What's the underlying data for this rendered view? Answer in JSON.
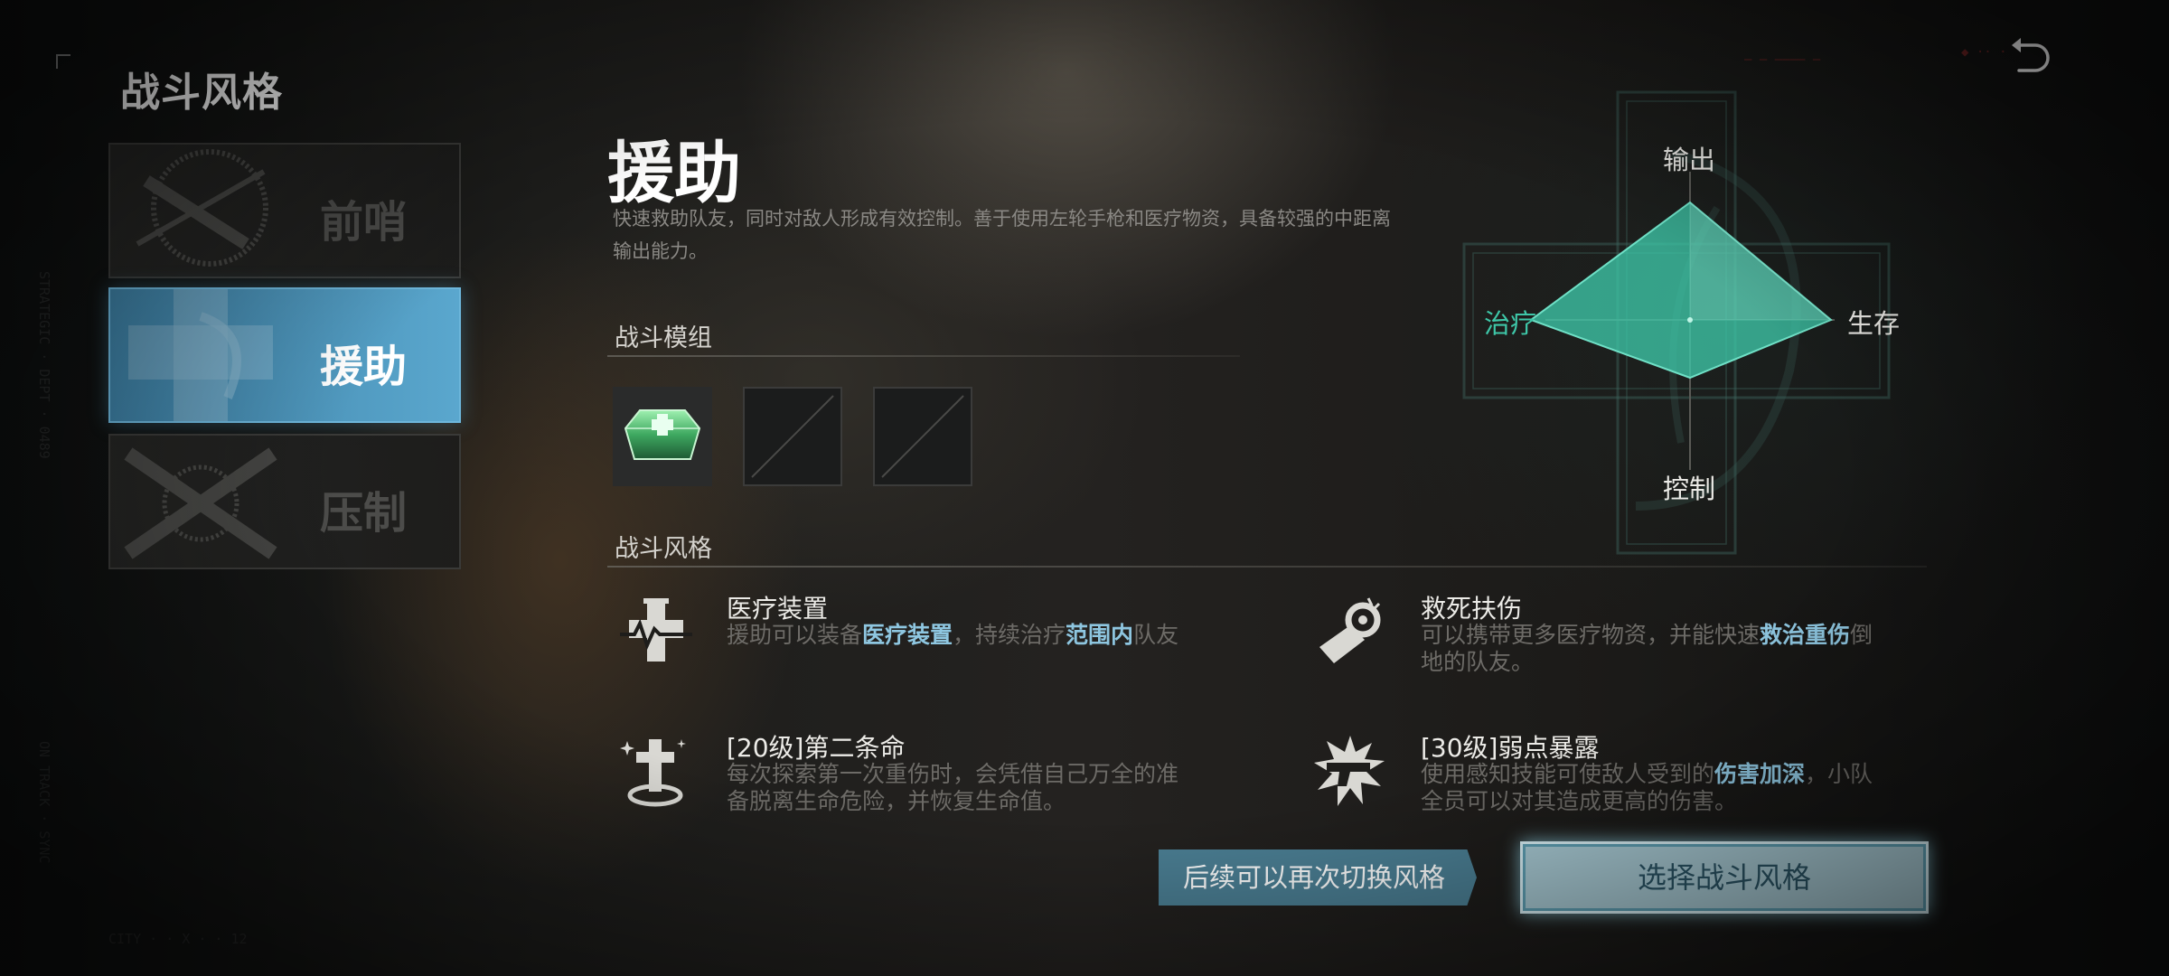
{
  "header": {
    "title": "战斗风格"
  },
  "sidebar": {
    "items": [
      {
        "label": "前哨",
        "selected": false
      },
      {
        "label": "援助",
        "selected": true
      },
      {
        "label": "压制",
        "selected": false
      }
    ]
  },
  "role": {
    "name": "援助",
    "description": "快速救助队友，同时对敌人形成有效控制。善于使用左轮手枪和医疗物资，具备较强的中距离输出能力。"
  },
  "modules": {
    "label": "战斗模组",
    "slots": [
      {
        "state": "filled",
        "icon": "medkit-gem-icon"
      },
      {
        "state": "empty"
      },
      {
        "state": "empty"
      }
    ]
  },
  "traits": {
    "label": "战斗风格",
    "items": [
      {
        "icon": "medical-device-icon",
        "title": "医疗装置",
        "desc": [
          {
            "t": "援助可以装备"
          },
          {
            "t": "医疗装置",
            "hl": true
          },
          {
            "t": "，持续治疗"
          },
          {
            "t": "范围内",
            "hl": true
          },
          {
            "t": "队友"
          }
        ]
      },
      {
        "icon": "bandage-roll-icon",
        "title": "救死扶伤",
        "desc": [
          {
            "t": "可以携带更多医疗物资，并能快速"
          },
          {
            "t": "救治重伤",
            "hl": true
          },
          {
            "t": "倒地的队友。"
          }
        ]
      },
      {
        "icon": "revive-cross-icon",
        "title": "[20级]第二条命",
        "desc": [
          {
            "t": "每次探索第一次重伤时，会凭借自己万全的准备脱离生命危险，并恢复生命值。"
          }
        ]
      },
      {
        "icon": "revolver-burst-icon",
        "title": "[30级]弱点暴露",
        "desc": [
          {
            "t": "使用感知技能可使敌人受到的"
          },
          {
            "t": "伤害加深",
            "hl": true
          },
          {
            "t": "，小队全员可以对其造成更高的伤害。"
          }
        ]
      }
    ]
  },
  "radar": {
    "axes": {
      "top": "输出",
      "right": "生存",
      "bottom": "控制",
      "left": "治疗"
    },
    "values": {
      "top": 0.65,
      "right": 0.78,
      "bottom": 0.32,
      "left": 0.88
    },
    "highlight_axis": "left",
    "accent_color": "#3ec7a8"
  },
  "footer": {
    "hint": "后续可以再次切换风格",
    "confirm_label": "选择战斗风格"
  },
  "colors": {
    "selected_card": "#5aa7ce",
    "highlight_text": "#8ec6e0",
    "hint_bg": "#4b7f94",
    "confirm_bg": "#a7c9d3"
  }
}
